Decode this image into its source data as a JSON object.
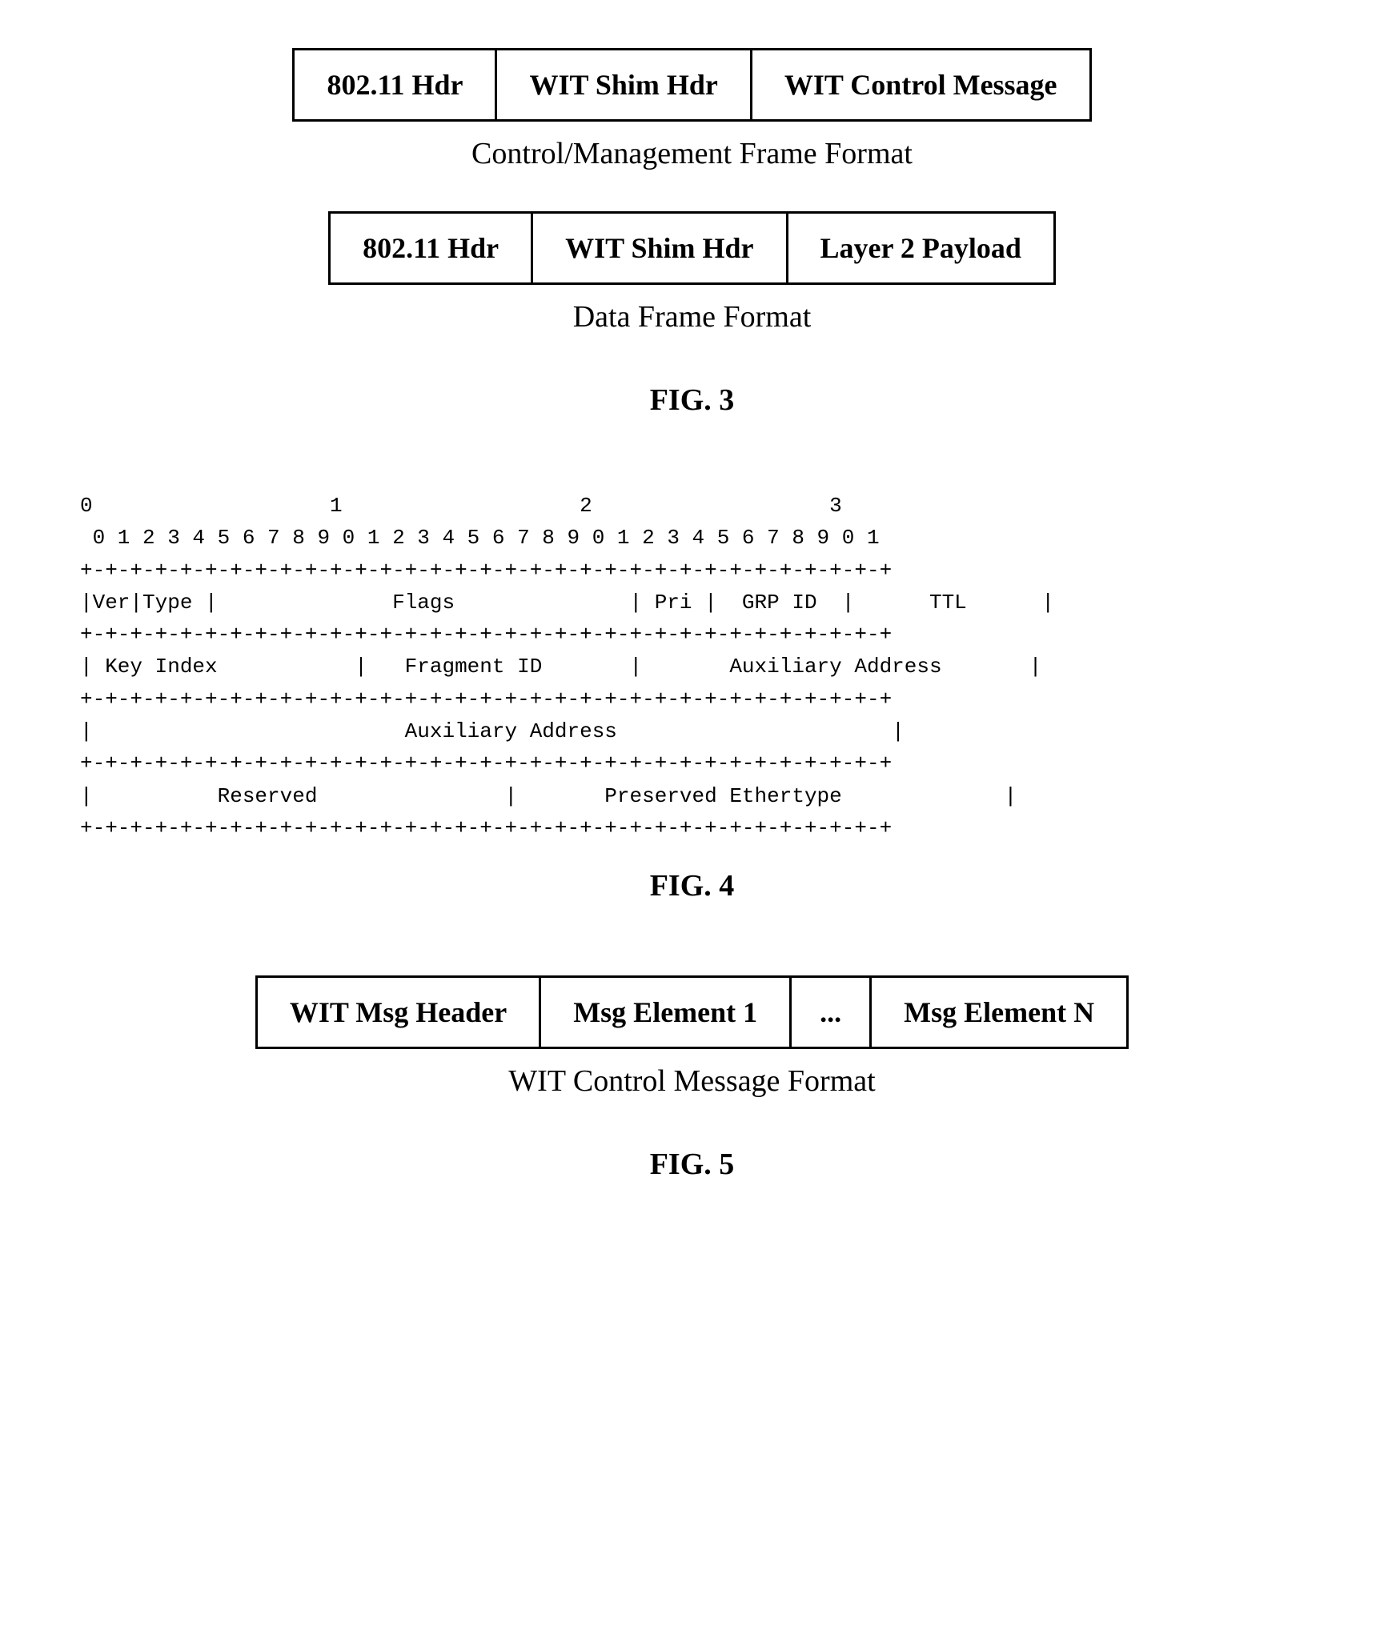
{
  "fig3": {
    "top_frame": {
      "cells": [
        "802.11 Hdr",
        "WIT Shim Hdr",
        "WIT Control Message"
      ]
    },
    "top_label": "Control/Management Frame Format",
    "bottom_frame": {
      "cells": [
        "802.11 Hdr",
        "WIT Shim Hdr",
        "Layer 2 Payload"
      ]
    },
    "bottom_label": "Data Frame Format",
    "fig_label": "FIG. 3"
  },
  "fig4": {
    "fig_label": "FIG. 4",
    "bit_diagram": "0                   1                   2                   3\n 0 1 2 3 4 5 6 7 8 9 0 1 2 3 4 5 6 7 8 9 0 1 2 3 4 5 6 7 8 9 0 1\n+-+-+-+-+-+-+-+-+-+-+-+-+-+-+-+-+-+-+-+-+-+-+-+-+-+-+-+-+-+-+-+-+\n|Ver|Type |               Flags             | Pri |  GRP ID  |      TTL      |\n+-+-+-+-+-+-+-+-+-+-+-+-+-+-+-+-+-+-+-+-+-+-+-+-+-+-+-+-+-+-+-+-+\n| Key Index           |   Fragment ID       |       Auxiliary Address       |\n+-+-+-+-+-+-+-+-+-+-+-+-+-+-+-+-+-+-+-+-+-+-+-+-+-+-+-+-+-+-+-+-+\n|                         Auxiliary Address                     |\n+-+-+-+-+-+-+-+-+-+-+-+-+-+-+-+-+-+-+-+-+-+-+-+-+-+-+-+-+-+-+-+-+\n|          Reserved               |         Preserved Ethertype           |\n+-+-+-+-+-+-+-+-+-+-+-+-+-+-+-+-+-+-+-+-+-+-+-+-+-+-+-+-+-+-+-+-+"
  },
  "fig5": {
    "frame": {
      "cells": [
        "WIT Msg Header",
        "Msg Element 1",
        "...",
        "Msg Element N"
      ]
    },
    "label": "WIT Control Message Format",
    "fig_label": "FIG. 5"
  }
}
